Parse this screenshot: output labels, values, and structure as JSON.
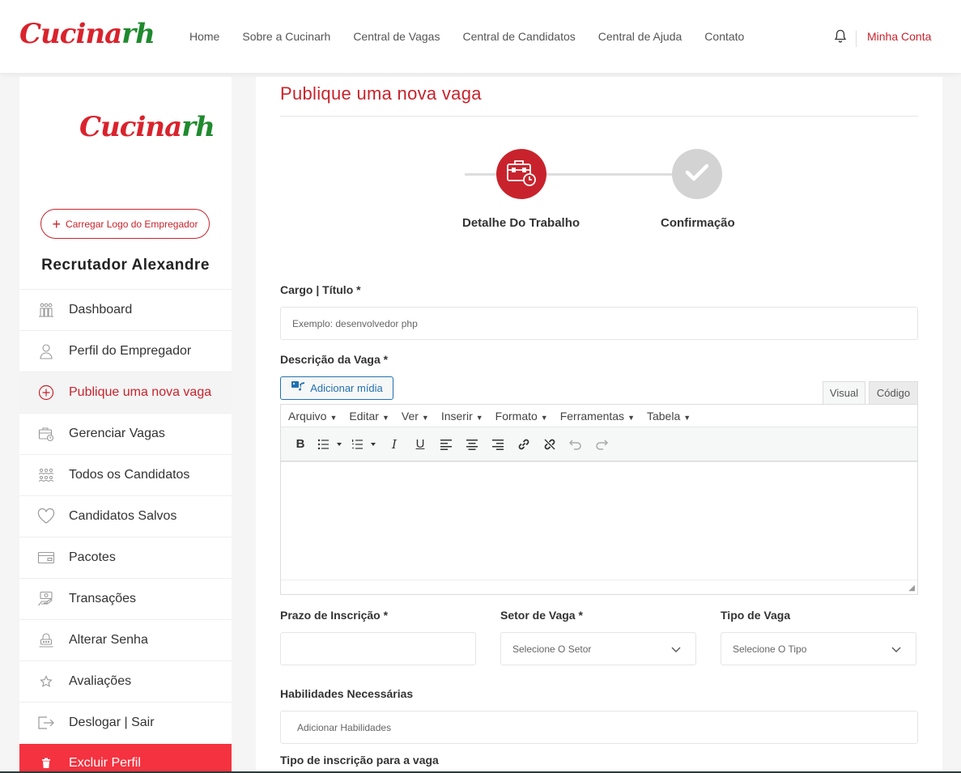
{
  "header": {
    "brand_part1": "Cucina",
    "brand_part2": "rh",
    "nav": [
      "Home",
      "Sobre a Cucinarh",
      "Central de Vagas",
      "Central de Candidatos",
      "Central de Ajuda",
      "Contato"
    ],
    "account_label": "Minha Conta"
  },
  "sidebar": {
    "logo_part1": "Cucina",
    "logo_part2": "rh",
    "upload_label": "Carregar Logo do Empregador",
    "recruiter_name": "Recrutador Alexandre",
    "items": [
      {
        "label": "Dashboard",
        "icon": "dashboard-icon"
      },
      {
        "label": "Perfil do Empregador",
        "icon": "user-icon"
      },
      {
        "label": "Publique uma nova vaga",
        "icon": "plus-circle-icon"
      },
      {
        "label": "Gerenciar Vagas",
        "icon": "briefcase-icon"
      },
      {
        "label": "Todos os Candidatos",
        "icon": "users-icon"
      },
      {
        "label": "Candidatos Salvos",
        "icon": "heart-icon"
      },
      {
        "label": "Pacotes",
        "icon": "card-icon"
      },
      {
        "label": "Transações",
        "icon": "money-icon"
      },
      {
        "label": "Alterar Senha",
        "icon": "lock-icon"
      },
      {
        "label": "Avaliações",
        "icon": "star-icon"
      },
      {
        "label": "Deslogar | Sair",
        "icon": "logout-icon"
      },
      {
        "label": "Excluir Perfil",
        "icon": "trash-icon"
      }
    ]
  },
  "main": {
    "title": "Publique uma nova vaga",
    "steps": [
      "Detalhe Do Trabalho",
      "Confirmação"
    ],
    "fields": {
      "title_label": "Cargo | Título *",
      "title_placeholder": "Exemplo: desenvolvedor php",
      "description_label": "Descrição da Vaga *",
      "media_button": "Adicionar mídia",
      "tab_visual": "Visual",
      "tab_code": "Código",
      "editor_menus": [
        "Arquivo",
        "Editar",
        "Ver",
        "Inserir",
        "Formato",
        "Ferramentas",
        "Tabela"
      ],
      "deadline_label": "Prazo de Inscrição *",
      "sector_label": "Setor de Vaga *",
      "sector_placeholder": "Selecione O Setor",
      "type_label": "Tipo de Vaga",
      "type_placeholder": "Selecione O Tipo",
      "skills_label": "Habilidades Necessárias",
      "skills_placeholder": "Adicionar Habilidades",
      "application_type_label": "Tipo de inscrição para a vaga"
    }
  },
  "colors": {
    "accent": "#c8232c",
    "brand_green": "#1f8a2e",
    "danger": "#f5323f",
    "link_blue": "#2271b1"
  }
}
